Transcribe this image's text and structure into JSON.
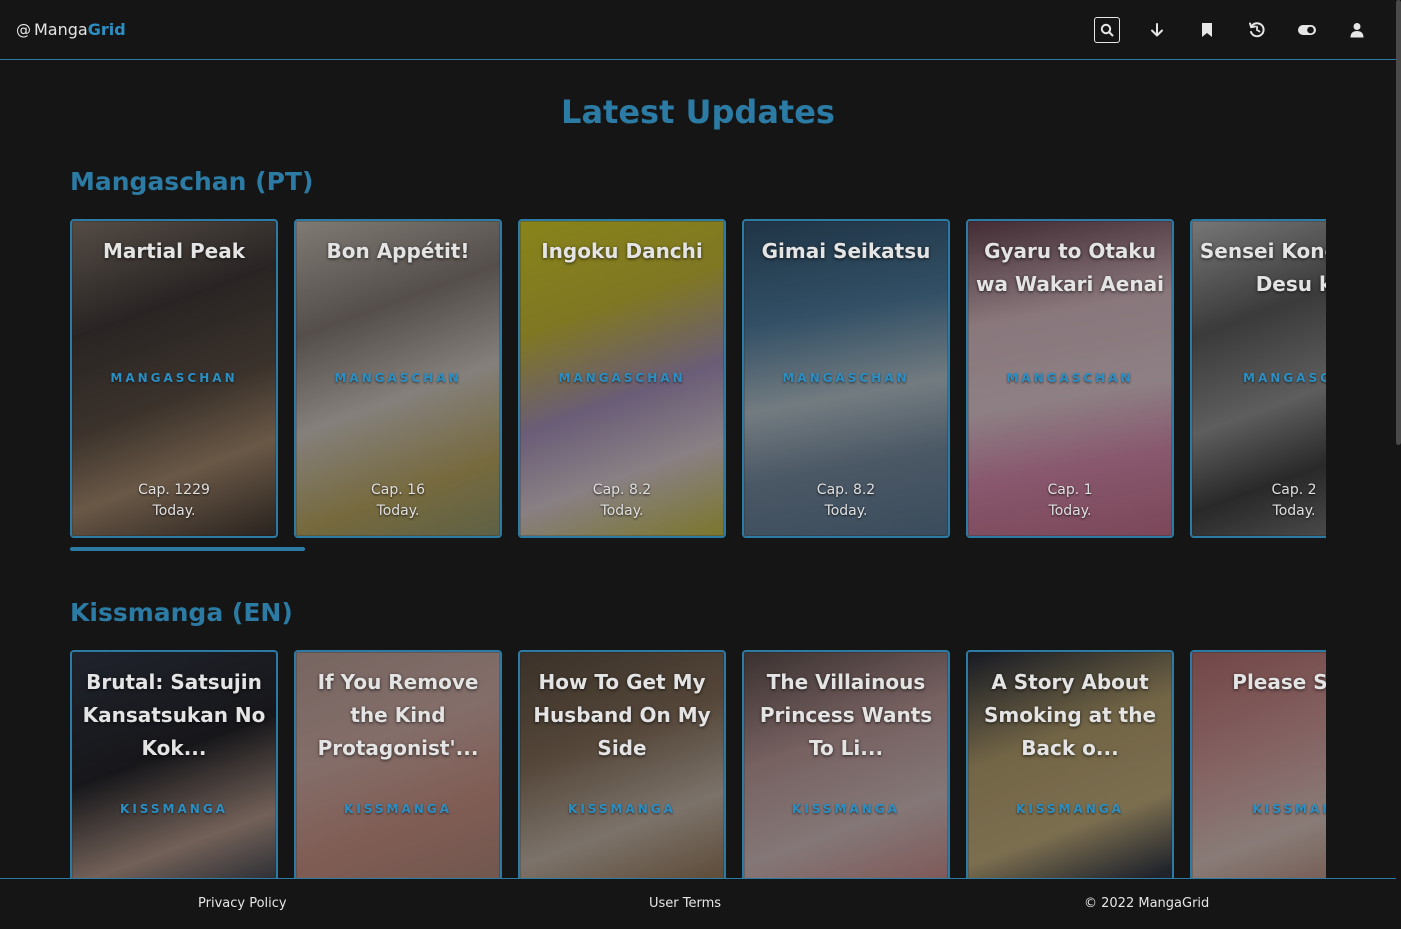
{
  "header": {
    "logo_prefix": "@",
    "logo_word1": "Manga",
    "logo_word2": "Grid",
    "nav": [
      {
        "icon": "search-icon",
        "label": "Search"
      },
      {
        "icon": "download-icon",
        "label": "Downloads"
      },
      {
        "icon": "bookmark-icon",
        "label": "Bookmarks"
      },
      {
        "icon": "history-icon",
        "label": "History"
      },
      {
        "icon": "theme-toggle-icon",
        "label": "Toggle theme"
      },
      {
        "icon": "user-icon",
        "label": "Profile"
      }
    ]
  },
  "main": {
    "title": "Latest Updates",
    "sections": [
      {
        "title": "Mangaschan (PT)",
        "cards": [
          {
            "title": "Martial Peak",
            "source": "MANGASCHAN",
            "chapter": "Cap. 1229",
            "date": "Today."
          },
          {
            "title": "Bon Appétit!",
            "source": "MANGASCHAN",
            "chapter": "Cap. 16",
            "date": "Today."
          },
          {
            "title": "Ingoku Danchi",
            "source": "MANGASCHAN",
            "chapter": "Cap. 8.2",
            "date": "Today."
          },
          {
            "title": "Gimai Seikatsu",
            "source": "MANGASCHAN",
            "chapter": "Cap. 8.2",
            "date": "Today."
          },
          {
            "title": "Gyaru to Otaku wa Wakari Aenai",
            "source": "MANGASCHAN",
            "chapter": "Cap. 1",
            "date": "Today."
          },
          {
            "title": "Sensei Kongetsu Desu k",
            "source": "MANGASCH",
            "chapter": "Cap. 2",
            "date": "Today."
          }
        ]
      },
      {
        "title": "Kissmanga (EN)",
        "cards": [
          {
            "title": "Brutal: Satsujin Kansatsukan No Kok...",
            "source": "KISSMANGA",
            "chapter": "",
            "date": ""
          },
          {
            "title": "If You Remove the Kind Protagonist'...",
            "source": "KISSMANGA",
            "chapter": "",
            "date": ""
          },
          {
            "title": "How To Get My Husband On My Side",
            "source": "KISSMANGA",
            "chapter": "",
            "date": ""
          },
          {
            "title": "The Villainous Princess Wants To Li...",
            "source": "KISSMANGA",
            "chapter": "",
            "date": ""
          },
          {
            "title": "A Story About Smoking at the Back o...",
            "source": "KISSMANGA",
            "chapter": "",
            "date": ""
          },
          {
            "title": "Please Sho",
            "source": "KISSMAN",
            "chapter": "",
            "date": ""
          }
        ]
      }
    ]
  },
  "footer": {
    "privacy": "Privacy Policy",
    "terms": "User Terms",
    "copyright": "© 2022 MangaGrid"
  },
  "colors": {
    "accent": "#2b7ba4",
    "background": "#151515"
  }
}
